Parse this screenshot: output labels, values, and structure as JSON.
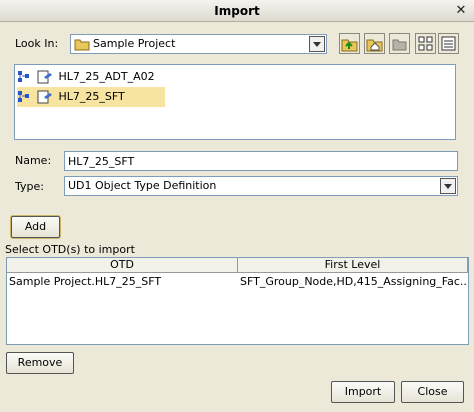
{
  "window": {
    "title": "Import"
  },
  "look_in": {
    "label": "Look In:",
    "value": "Sample Project"
  },
  "tree": {
    "items": [
      {
        "label": "HL7_25_ADT_A02",
        "selected": false
      },
      {
        "label": "HL7_25_SFT",
        "selected": true
      }
    ]
  },
  "name": {
    "label": "Name:",
    "value": "HL7_25_SFT"
  },
  "type": {
    "label": "Type:",
    "value": "UD1 Object Type Definition"
  },
  "buttons": {
    "add": "Add",
    "remove": "Remove",
    "import": "Import",
    "close": "Close"
  },
  "otd_table": {
    "caption": "Select OTD(s) to import",
    "columns": [
      "OTD",
      "First Level"
    ],
    "rows": [
      [
        "Sample Project.HL7_25_SFT",
        "SFT_Group_Node,HD,415_Assigning_Fac..."
      ]
    ]
  },
  "colors": {
    "selection": "#f7e4a0",
    "background": "#ece9d8",
    "border": "#7f9db9"
  }
}
